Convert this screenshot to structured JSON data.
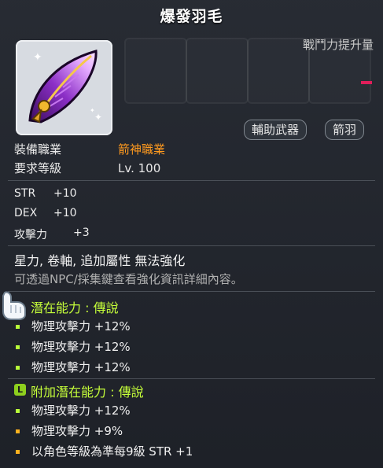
{
  "title": "爆發羽毛",
  "power_label": "戰鬥力提升量",
  "tags": [
    "輔助武器",
    "箭羽"
  ],
  "requirements": {
    "job_key": "裝備職業",
    "job_value": "箭神職業",
    "level_key": "要求等級",
    "level_value": "Lv. 100"
  },
  "stats": [
    {
      "name": "STR",
      "value": "+10"
    },
    {
      "name": "DEX",
      "value": "+10"
    },
    {
      "name": "攻擊力",
      "value": "+3"
    }
  ],
  "desc_line1": "星力, 卷軸, 追加屬性 無法強化",
  "desc_line2": "可透過NPC/採集鍵查看強化資訊詳細內容。",
  "potential": {
    "header": "潛在能力 : 傳說",
    "lines": [
      "物理攻擊力 +12%",
      "物理攻擊力 +12%",
      "物理攻擊力 +12%"
    ]
  },
  "bonus_potential": {
    "badge": "L",
    "header": "附加潛在能力 : 傳說",
    "lines": [
      {
        "text": "物理攻擊力 +12%",
        "color": "#b8ff3a"
      },
      {
        "text": "物理攻擊力 +9%",
        "color": "#ffb21f"
      },
      {
        "text": "以角色等級為準每9級 STR +1",
        "color": "#ffb21f"
      }
    ]
  },
  "colors": {
    "job": "#ff9a1f",
    "potential": "#c6ff3a",
    "power_bar": "#e01e5a"
  }
}
